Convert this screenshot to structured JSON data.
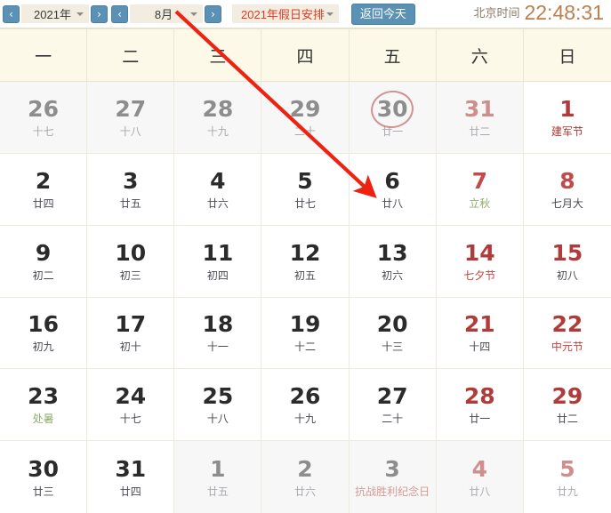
{
  "toolbar": {
    "prev_year_label": "‹",
    "next_year_label": "›",
    "prev_month_label": "‹",
    "next_month_label": "›",
    "year_value": "2021年",
    "month_value": "8月",
    "holiday_value": "2021年假日安排",
    "today_button_label": "返回今天",
    "clock_label": "北京时间",
    "clock_time": "22:48:31"
  },
  "calendar": {
    "weekdays": [
      "一",
      "二",
      "三",
      "四",
      "五",
      "六",
      "日"
    ],
    "weeks": [
      [
        {
          "num": "26",
          "sub": "十七",
          "num_class": "dim",
          "sub_class": "dim",
          "other": true
        },
        {
          "num": "27",
          "sub": "十八",
          "num_class": "dim",
          "sub_class": "dim",
          "other": true
        },
        {
          "num": "28",
          "sub": "十九",
          "num_class": "dim",
          "sub_class": "dim",
          "other": true
        },
        {
          "num": "29",
          "sub": "二十",
          "num_class": "dim",
          "sub_class": "dim",
          "other": true
        },
        {
          "num": "30",
          "sub": "廿一",
          "num_class": "dim",
          "sub_class": "dim",
          "other": true,
          "circled": true
        },
        {
          "num": "31",
          "sub": "廿二",
          "num_class": "dim-red",
          "sub_class": "dim",
          "other": true
        },
        {
          "num": "1",
          "sub": "建军节",
          "num_class": "red",
          "sub_class": "darkred",
          "other": false
        }
      ],
      [
        {
          "num": "2",
          "sub": "廿四",
          "num_class": "",
          "sub_class": "",
          "other": false
        },
        {
          "num": "3",
          "sub": "廿五",
          "num_class": "",
          "sub_class": "",
          "other": false
        },
        {
          "num": "4",
          "sub": "廿六",
          "num_class": "",
          "sub_class": "",
          "other": false
        },
        {
          "num": "5",
          "sub": "廿七",
          "num_class": "",
          "sub_class": "",
          "other": false
        },
        {
          "num": "6",
          "sub": "廿八",
          "num_class": "",
          "sub_class": "",
          "other": false
        },
        {
          "num": "7",
          "sub": "立秋",
          "num_class": "rose",
          "sub_class": "green",
          "other": false
        },
        {
          "num": "8",
          "sub": "七月大",
          "num_class": "rose",
          "sub_class": "",
          "other": false
        }
      ],
      [
        {
          "num": "9",
          "sub": "初二",
          "num_class": "",
          "sub_class": "",
          "other": false
        },
        {
          "num": "10",
          "sub": "初三",
          "num_class": "",
          "sub_class": "",
          "other": false
        },
        {
          "num": "11",
          "sub": "初四",
          "num_class": "",
          "sub_class": "",
          "other": false
        },
        {
          "num": "12",
          "sub": "初五",
          "num_class": "",
          "sub_class": "",
          "other": false
        },
        {
          "num": "13",
          "sub": "初六",
          "num_class": "",
          "sub_class": "",
          "other": false
        },
        {
          "num": "14",
          "sub": "七夕节",
          "num_class": "red",
          "sub_class": "red",
          "other": false
        },
        {
          "num": "15",
          "sub": "初八",
          "num_class": "red",
          "sub_class": "",
          "other": false
        }
      ],
      [
        {
          "num": "16",
          "sub": "初九",
          "num_class": "",
          "sub_class": "",
          "other": false
        },
        {
          "num": "17",
          "sub": "初十",
          "num_class": "",
          "sub_class": "",
          "other": false
        },
        {
          "num": "18",
          "sub": "十一",
          "num_class": "",
          "sub_class": "",
          "other": false
        },
        {
          "num": "19",
          "sub": "十二",
          "num_class": "",
          "sub_class": "",
          "other": false
        },
        {
          "num": "20",
          "sub": "十三",
          "num_class": "",
          "sub_class": "",
          "other": false
        },
        {
          "num": "21",
          "sub": "十四",
          "num_class": "red",
          "sub_class": "",
          "other": false
        },
        {
          "num": "22",
          "sub": "中元节",
          "num_class": "red",
          "sub_class": "red",
          "other": false
        }
      ],
      [
        {
          "num": "23",
          "sub": "处暑",
          "num_class": "",
          "sub_class": "green",
          "other": false
        },
        {
          "num": "24",
          "sub": "十七",
          "num_class": "",
          "sub_class": "",
          "other": false
        },
        {
          "num": "25",
          "sub": "十八",
          "num_class": "",
          "sub_class": "",
          "other": false
        },
        {
          "num": "26",
          "sub": "十九",
          "num_class": "",
          "sub_class": "",
          "other": false
        },
        {
          "num": "27",
          "sub": "二十",
          "num_class": "",
          "sub_class": "",
          "other": false
        },
        {
          "num": "28",
          "sub": "廿一",
          "num_class": "red",
          "sub_class": "",
          "other": false
        },
        {
          "num": "29",
          "sub": "廿二",
          "num_class": "red",
          "sub_class": "",
          "other": false
        }
      ],
      [
        {
          "num": "30",
          "sub": "廿三",
          "num_class": "",
          "sub_class": "",
          "other": false
        },
        {
          "num": "31",
          "sub": "廿四",
          "num_class": "",
          "sub_class": "",
          "other": false
        },
        {
          "num": "1",
          "sub": "廿五",
          "num_class": "dim",
          "sub_class": "dim",
          "other": true
        },
        {
          "num": "2",
          "sub": "廿六",
          "num_class": "dim",
          "sub_class": "dim",
          "other": true
        },
        {
          "num": "3",
          "sub": "抗战胜利纪念日",
          "num_class": "dim",
          "sub_class": "dim-red",
          "other": true
        },
        {
          "num": "4",
          "sub": "廿八",
          "num_class": "dim-red",
          "sub_class": "dim",
          "other": true
        },
        {
          "num": "5",
          "sub": "廿九",
          "num_class": "dim-red",
          "sub_class": "dim",
          "other": true
        }
      ]
    ]
  },
  "annotations": {
    "arrow_color": "#ee2211",
    "circle_color": "#c9817f"
  }
}
